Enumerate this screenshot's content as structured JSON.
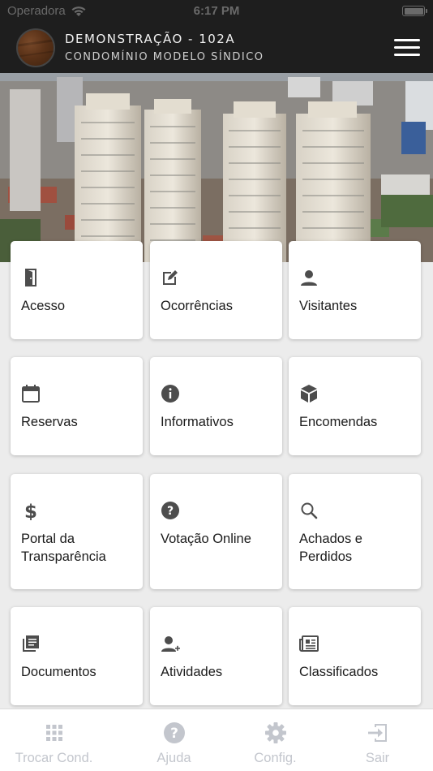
{
  "status_bar": {
    "carrier": "Operadora",
    "time": "6:17 PM"
  },
  "header": {
    "title": "DEMONSTRAÇÃO - 102A",
    "subtitle": "CONDOMÍNIO MODELO SÍNDICO"
  },
  "grid": {
    "acesso": "Acesso",
    "ocorrencias": "Ocorrências",
    "visitantes": "Visitantes",
    "reservas": "Reservas",
    "informativos": "Informativos",
    "encomendas": "Encomendas",
    "portal": "Portal da Transparência",
    "votacao": "Votação Online",
    "achados": "Achados e Perdidos",
    "documentos": "Documentos",
    "atividades": "Atividades",
    "classificados": "Classificados"
  },
  "bottom_nav": {
    "trocar": "Trocar Cond.",
    "ajuda": "Ajuda",
    "config": "Config.",
    "sair": "Sair"
  },
  "colors": {
    "header_bg": "#1e1e1e",
    "icon": "#4d4d4d",
    "nav_inactive": "#c3c6cd"
  }
}
